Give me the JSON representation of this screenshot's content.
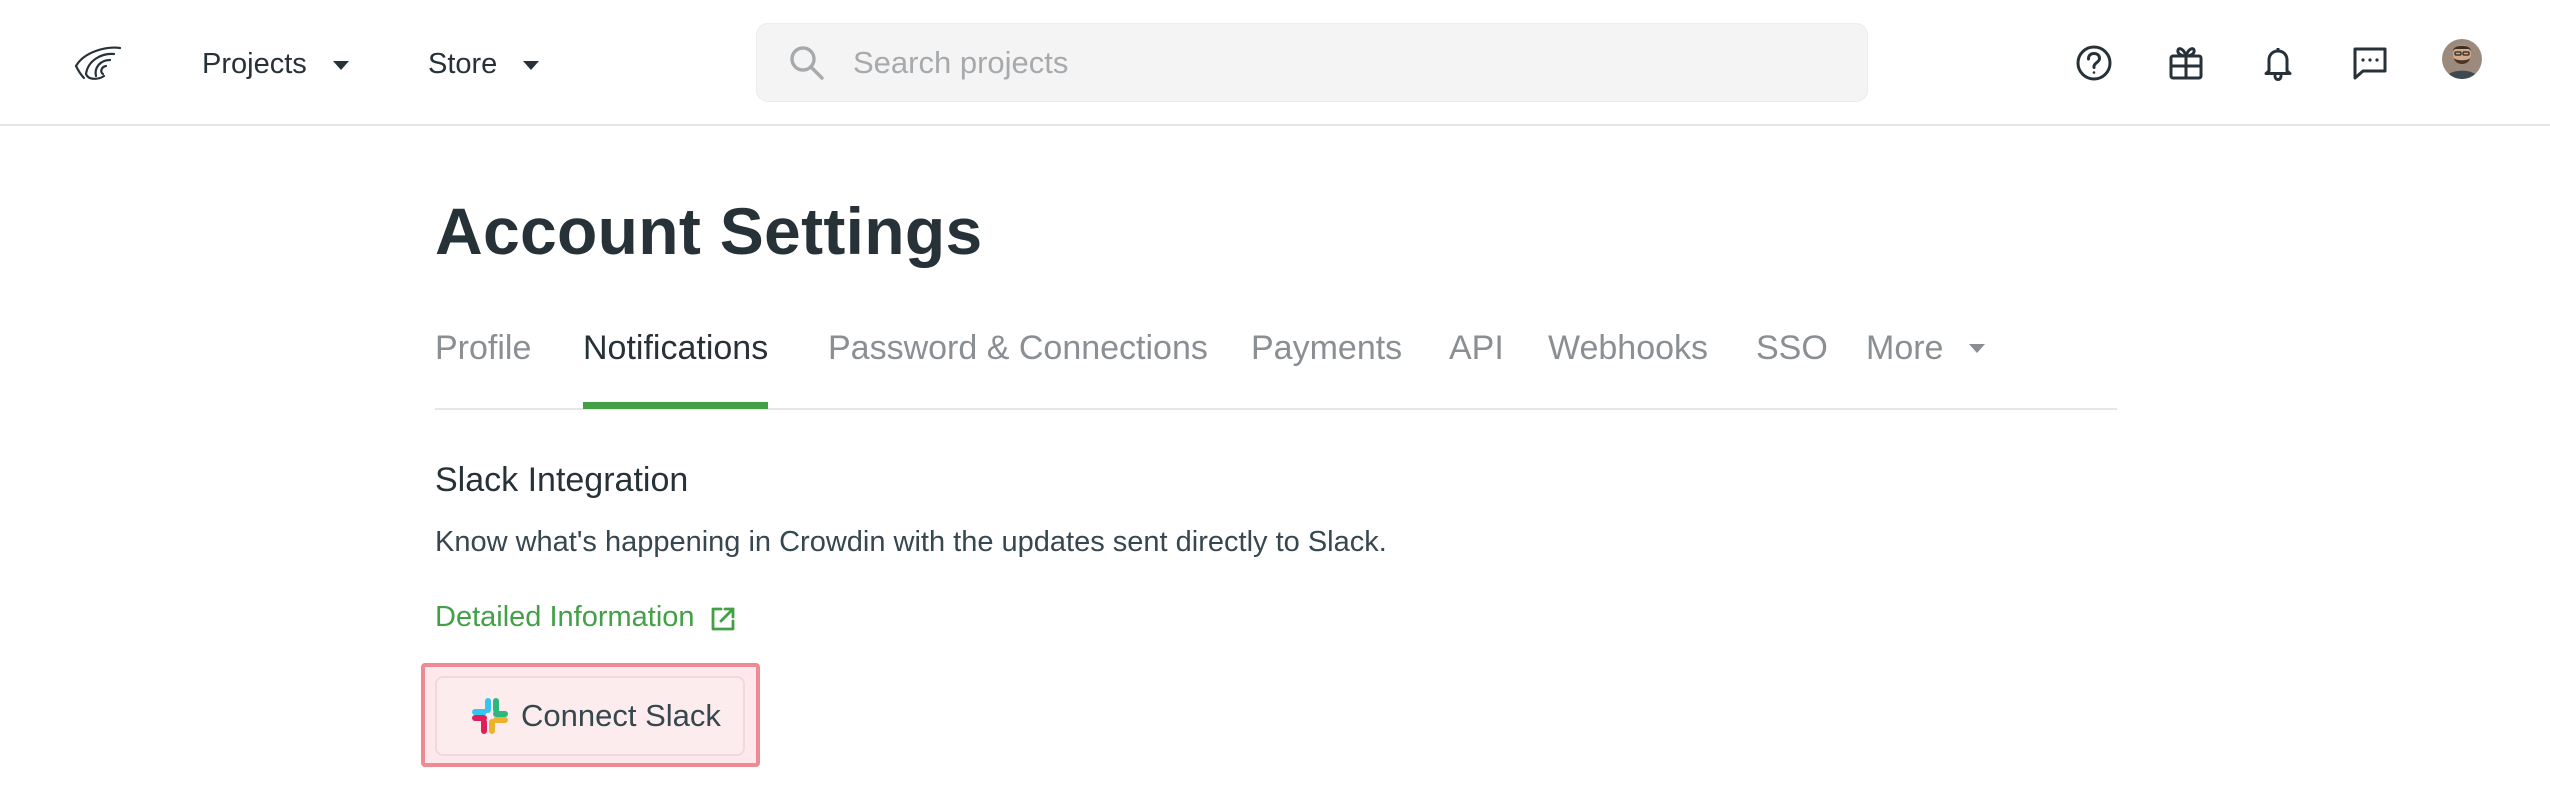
{
  "colors": {
    "accent_green": "#43a047",
    "text_dark": "#263238",
    "text_muted": "#8a8f93",
    "highlight_border": "#ef8a93",
    "highlight_fill": "#ffcdd2"
  },
  "topbar": {
    "logo_icon": "crowdin-logo-icon",
    "menus": [
      {
        "label": "Projects",
        "icon": "caret-down-icon"
      },
      {
        "label": "Store",
        "icon": "caret-down-icon"
      }
    ],
    "search": {
      "placeholder": "Search projects",
      "value": "",
      "icon": "search-icon"
    },
    "icons": [
      "help-icon",
      "gift-icon",
      "bell-icon",
      "chat-icon"
    ],
    "avatar": "user-avatar"
  },
  "page": {
    "title": "Account Settings"
  },
  "tabs": [
    {
      "label": "Profile",
      "active": false
    },
    {
      "label": "Notifications",
      "active": true
    },
    {
      "label": "Password & Connections",
      "active": false
    },
    {
      "label": "Payments",
      "active": false
    },
    {
      "label": "API",
      "active": false
    },
    {
      "label": "Webhooks",
      "active": false
    },
    {
      "label": "SSO",
      "active": false
    },
    {
      "label": "More",
      "active": false
    }
  ],
  "slack": {
    "title": "Slack Integration",
    "description": "Know what's happening in Crowdin with the updates sent directly to Slack.",
    "link_label": "Detailed Information",
    "link_icon": "external-link-icon",
    "button_label": "Connect Slack",
    "button_icon": "slack-icon"
  }
}
